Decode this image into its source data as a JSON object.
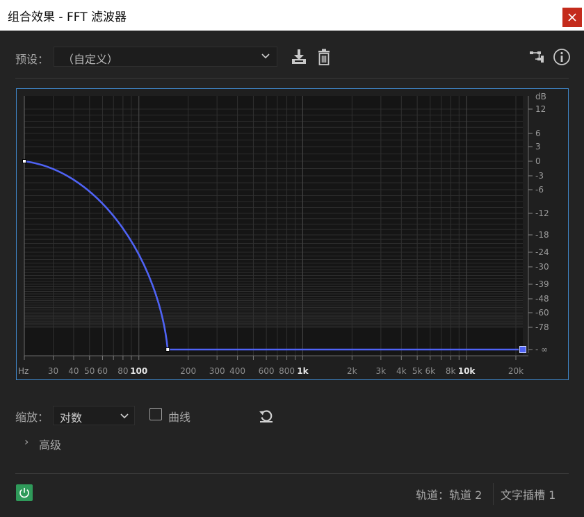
{
  "window": {
    "title": "组合效果 - FFT 滤波器",
    "close_glyph": "x"
  },
  "preset": {
    "label": "预设：",
    "value": "（自定义）",
    "icons": [
      "download-icon",
      "trash-icon",
      "routing-icon",
      "info-icon"
    ]
  },
  "graph": {
    "db_unit": "dB",
    "db_ticks": [
      {
        "label": "12",
        "db": 12
      },
      {
        "label": "6",
        "db": 6
      },
      {
        "label": "3",
        "db": 3
      },
      {
        "label": "0",
        "db": 0
      },
      {
        "label": "-3",
        "db": -3
      },
      {
        "label": "-6",
        "db": -6
      },
      {
        "label": "-12",
        "db": -12
      },
      {
        "label": "-18",
        "db": -18
      },
      {
        "label": "-24",
        "db": -24
      },
      {
        "label": "-30",
        "db": -30
      },
      {
        "label": "-39",
        "db": -39
      },
      {
        "label": "-48",
        "db": -48
      },
      {
        "label": "-60",
        "db": -60
      },
      {
        "label": "-78",
        "db": -78
      },
      {
        "label": "- ∞",
        "db": -1000
      }
    ],
    "hz_unit": "Hz",
    "freq_ticks": [
      {
        "label": "30",
        "hz": 30,
        "bold": false
      },
      {
        "label": "40",
        "hz": 40,
        "bold": false
      },
      {
        "label": "50",
        "hz": 50,
        "bold": false
      },
      {
        "label": "60",
        "hz": 60,
        "bold": false
      },
      {
        "label": "80",
        "hz": 80,
        "bold": false
      },
      {
        "label": "100",
        "hz": 100,
        "bold": true
      },
      {
        "label": "200",
        "hz": 200,
        "bold": false
      },
      {
        "label": "300",
        "hz": 300,
        "bold": false
      },
      {
        "label": "400",
        "hz": 400,
        "bold": false
      },
      {
        "label": "600",
        "hz": 600,
        "bold": false
      },
      {
        "label": "800",
        "hz": 800,
        "bold": false
      },
      {
        "label": "1k",
        "hz": 1000,
        "bold": true
      },
      {
        "label": "2k",
        "hz": 2000,
        "bold": false
      },
      {
        "label": "3k",
        "hz": 3000,
        "bold": false
      },
      {
        "label": "4k",
        "hz": 4000,
        "bold": false
      },
      {
        "label": "5k",
        "hz": 5000,
        "bold": false
      },
      {
        "label": "6k",
        "hz": 6000,
        "bold": false
      },
      {
        "label": "8k",
        "hz": 8000,
        "bold": false
      },
      {
        "label": "10k",
        "hz": 10000,
        "bold": true
      },
      {
        "label": "20k",
        "hz": 20000,
        "bold": false
      }
    ],
    "curve_color": "#4f63f5",
    "control_points": [
      {
        "hz": 20,
        "db": 0
      },
      {
        "hz": 150,
        "db": -1000
      },
      {
        "hz": 22050,
        "db": -1000
      }
    ]
  },
  "zoom": {
    "label": "缩放：",
    "value": "对数"
  },
  "curve_option": {
    "label": "曲线",
    "checked": false
  },
  "advanced": {
    "chevron": "›",
    "label": "高级"
  },
  "status": {
    "track": "轨道：轨道 2",
    "slot": "文字插槽 1"
  },
  "power_on": true
}
